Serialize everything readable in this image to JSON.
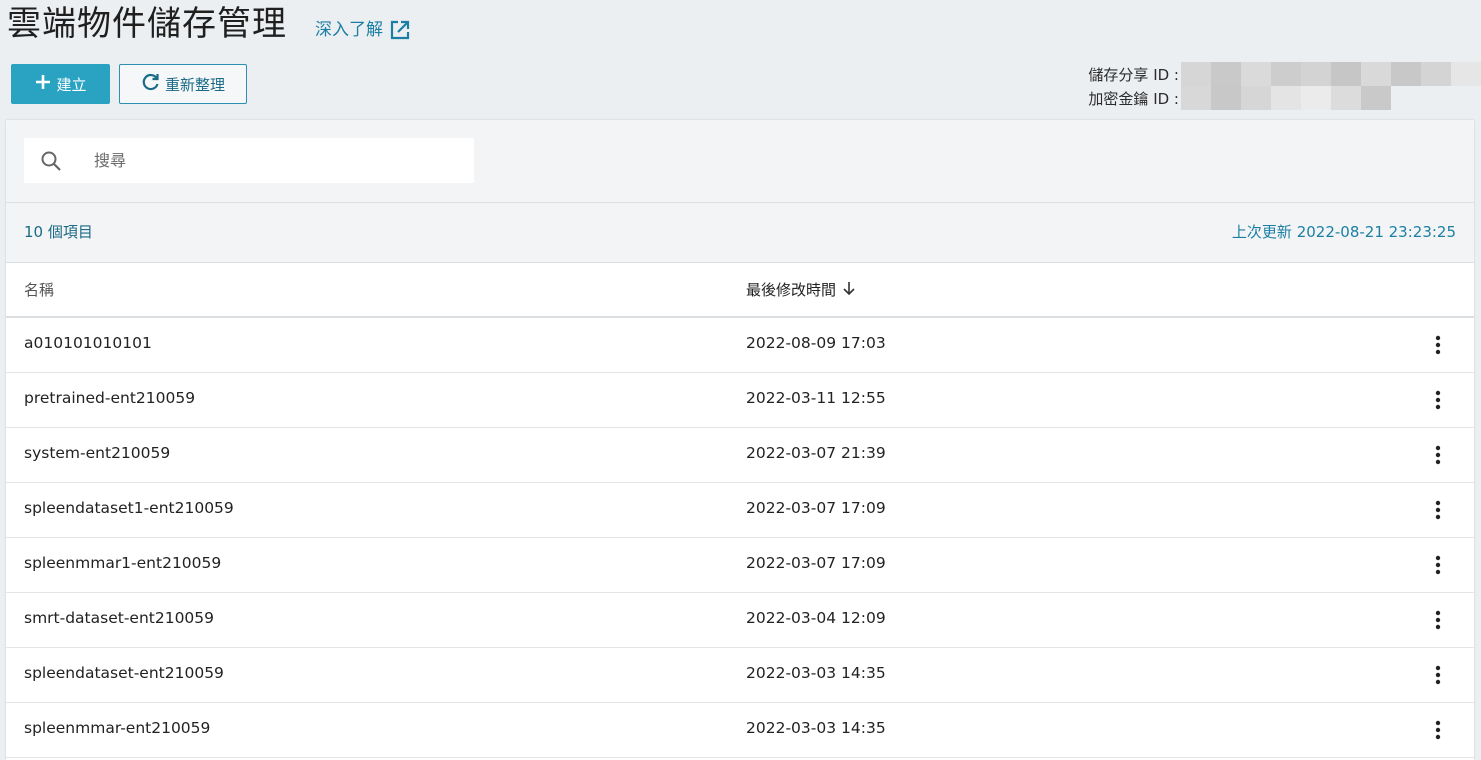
{
  "header": {
    "title": "雲端物件儲存管理",
    "learn_more": "深入了解"
  },
  "toolbar": {
    "create_label": "建立",
    "refresh_label": "重新整理"
  },
  "ids": {
    "share_id_label": "儲存分享 ID :",
    "key_id_label": "加密金鑰 ID :"
  },
  "search": {
    "placeholder": "搜尋",
    "value": ""
  },
  "summary": {
    "item_count": "10 個項目",
    "last_updated": "上次更新 2022-08-21 23:23:25"
  },
  "table": {
    "columns": {
      "name": "名稱",
      "modified": "最後修改時間"
    },
    "rows": [
      {
        "name": "a010101010101",
        "modified": "2022-08-09 17:03"
      },
      {
        "name": "pretrained-ent210059",
        "modified": "2022-03-11 12:55"
      },
      {
        "name": "system-ent210059",
        "modified": "2022-03-07 21:39"
      },
      {
        "name": "spleendataset1-ent210059",
        "modified": "2022-03-07 17:09"
      },
      {
        "name": "spleenmmar1-ent210059",
        "modified": "2022-03-07 17:09"
      },
      {
        "name": "smrt-dataset-ent210059",
        "modified": "2022-03-04 12:09"
      },
      {
        "name": "spleendataset-ent210059",
        "modified": "2022-03-03 14:35"
      },
      {
        "name": "spleenmmar-ent210059",
        "modified": "2022-03-03 14:35"
      }
    ]
  },
  "colors": {
    "accent": "#2aa3c3",
    "link": "#1b7fa3"
  }
}
